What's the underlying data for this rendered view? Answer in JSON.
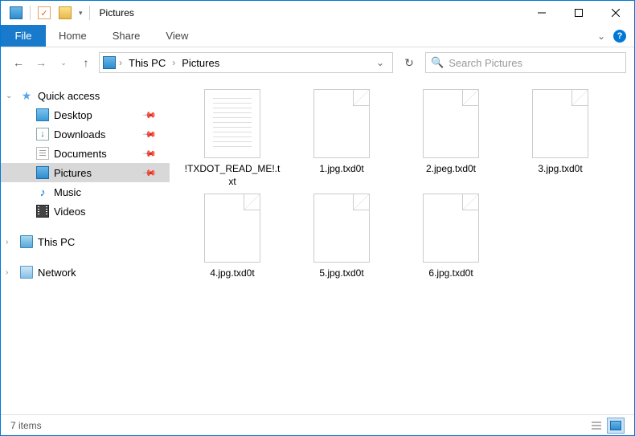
{
  "window": {
    "title": "Pictures"
  },
  "ribbon": {
    "file": "File",
    "tabs": [
      "Home",
      "Share",
      "View"
    ]
  },
  "breadcrumb": {
    "items": [
      "This PC",
      "Pictures"
    ]
  },
  "search": {
    "placeholder": "Search Pictures"
  },
  "sidebar": {
    "quick_access": "Quick access",
    "items": [
      {
        "label": "Desktop",
        "icon": "desktop",
        "pinned": true
      },
      {
        "label": "Downloads",
        "icon": "downloads",
        "pinned": true
      },
      {
        "label": "Documents",
        "icon": "documents",
        "pinned": true
      },
      {
        "label": "Pictures",
        "icon": "pictures",
        "pinned": true,
        "selected": true
      },
      {
        "label": "Music",
        "icon": "music",
        "pinned": false
      },
      {
        "label": "Videos",
        "icon": "videos",
        "pinned": false
      }
    ],
    "this_pc": "This PC",
    "network": "Network"
  },
  "files": [
    {
      "name": "!TXDOT_READ_ME!.txt",
      "type": "txt"
    },
    {
      "name": "1.jpg.txd0t",
      "type": "blank"
    },
    {
      "name": "2.jpeg.txd0t",
      "type": "blank"
    },
    {
      "name": "3.jpg.txd0t",
      "type": "blank"
    },
    {
      "name": "4.jpg.txd0t",
      "type": "blank"
    },
    {
      "name": "5.jpg.txd0t",
      "type": "blank"
    },
    {
      "name": "6.jpg.txd0t",
      "type": "blank"
    }
  ],
  "status": {
    "count": "7 items"
  }
}
